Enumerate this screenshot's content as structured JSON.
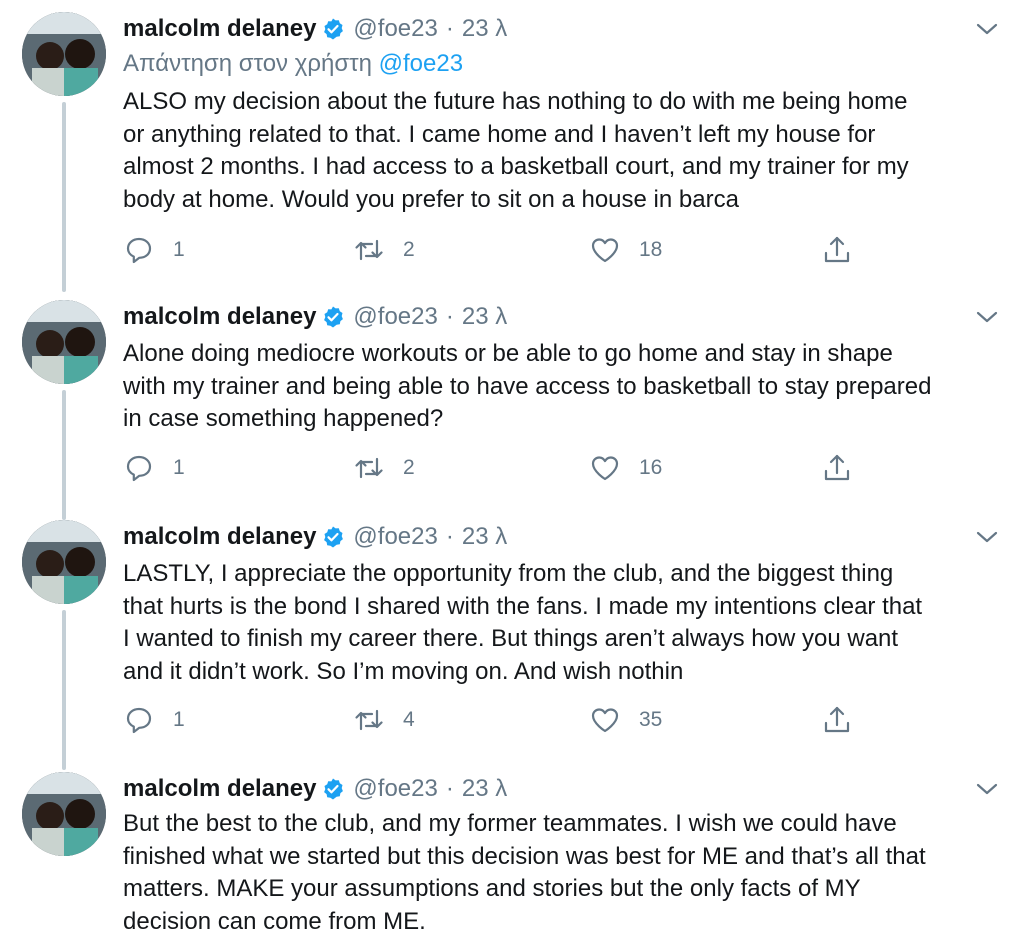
{
  "colors": {
    "name": "#14171a",
    "secondary": "#657786",
    "link": "#1da1f2",
    "verified": "#1da1f2",
    "thread_line": "#c4cfd6"
  },
  "icons": {
    "verified": "verified-badge-icon",
    "menu": "chevron-down-icon",
    "reply": "reply-bubble-icon",
    "retweet": "retweet-icon",
    "like": "heart-icon",
    "share": "share-icon"
  },
  "tweets": [
    {
      "name": "malcolm delaney",
      "handle": "@foe23",
      "separator": "·",
      "time": "23 λ",
      "reply_prefix": "Απάντηση στον χρήστη",
      "reply_mention": "@foe23",
      "lines": [
        "ALSO my decision about the future has nothing to do with me being home",
        "or anything related to that. I came home and I haven’t left my house for",
        "almost 2 months. I had access to a basketball court, and my trainer for my",
        "body at home. Would you prefer to sit on a house in barca"
      ],
      "replies": "1",
      "retweets": "2",
      "likes": "18"
    },
    {
      "name": "malcolm delaney",
      "handle": "@foe23",
      "separator": "·",
      "time": "23 λ",
      "lines": [
        "Alone doing mediocre workouts or be able to go home and stay in shape",
        "with my trainer and being able to have access to basketball to stay prepared",
        "in case something happened?"
      ],
      "replies": "1",
      "retweets": "2",
      "likes": "16"
    },
    {
      "name": "malcolm delaney",
      "handle": "@foe23",
      "separator": "·",
      "time": "23 λ",
      "lines": [
        "LASTLY, I appreciate the opportunity from the club, and the biggest thing",
        "that hurts is the bond I shared with the fans. I made my intentions clear that",
        "I wanted to finish my career there. But things aren’t always how you want",
        "and it didn’t work. So I’m moving on. And wish nothin"
      ],
      "replies": "1",
      "retweets": "4",
      "likes": "35"
    },
    {
      "name": "malcolm delaney",
      "handle": "@foe23",
      "separator": "·",
      "time": "23 λ",
      "lines": [
        "But the best to the club, and my former teammates. I wish we could have",
        "finished what we started but this decision was best for ME and that’s all that",
        "matters. MAKE your assumptions and stories but the only facts of MY",
        "decision can come from ME."
      ]
    }
  ]
}
